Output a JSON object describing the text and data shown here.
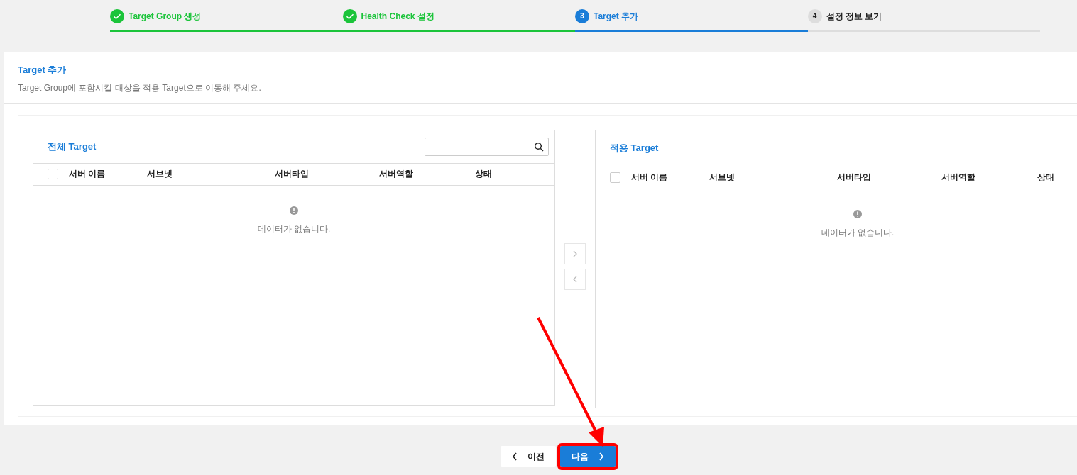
{
  "steps": [
    {
      "label": "Target Group 생성",
      "kind": "done"
    },
    {
      "label": "Health Check 설정",
      "kind": "done"
    },
    {
      "number": "3",
      "label": "Target 추가",
      "kind": "current"
    },
    {
      "number": "4",
      "label": "설정 정보 보기",
      "kind": "pending"
    }
  ],
  "section": {
    "title": "Target 추가",
    "description": "Target Group에 포함시킬 대상을 적용 Target으로 이동해 주세요."
  },
  "panels": [
    {
      "title": "전체 Target",
      "has_search": true,
      "columns": [
        "서버 이름",
        "서브넷",
        "서버타입",
        "서버역할",
        "상태"
      ],
      "select_all": false,
      "empty_text": "데이터가 없습니다."
    },
    {
      "title": "적용 Target",
      "has_search": false,
      "columns": [
        "서버 이름",
        "서브넷",
        "서버타입",
        "서버역할",
        "상태"
      ],
      "select_all": false,
      "empty_text": "데이터가 없습니다."
    }
  ],
  "transfer_buttons": [
    {
      "kind": "right",
      "disabled": true
    },
    {
      "kind": "left",
      "disabled": true
    }
  ],
  "footer_buttons": [
    {
      "label": "이전",
      "kind": "prev",
      "highlighted": false
    },
    {
      "label": "다음",
      "kind": "next",
      "highlighted": true
    }
  ]
}
